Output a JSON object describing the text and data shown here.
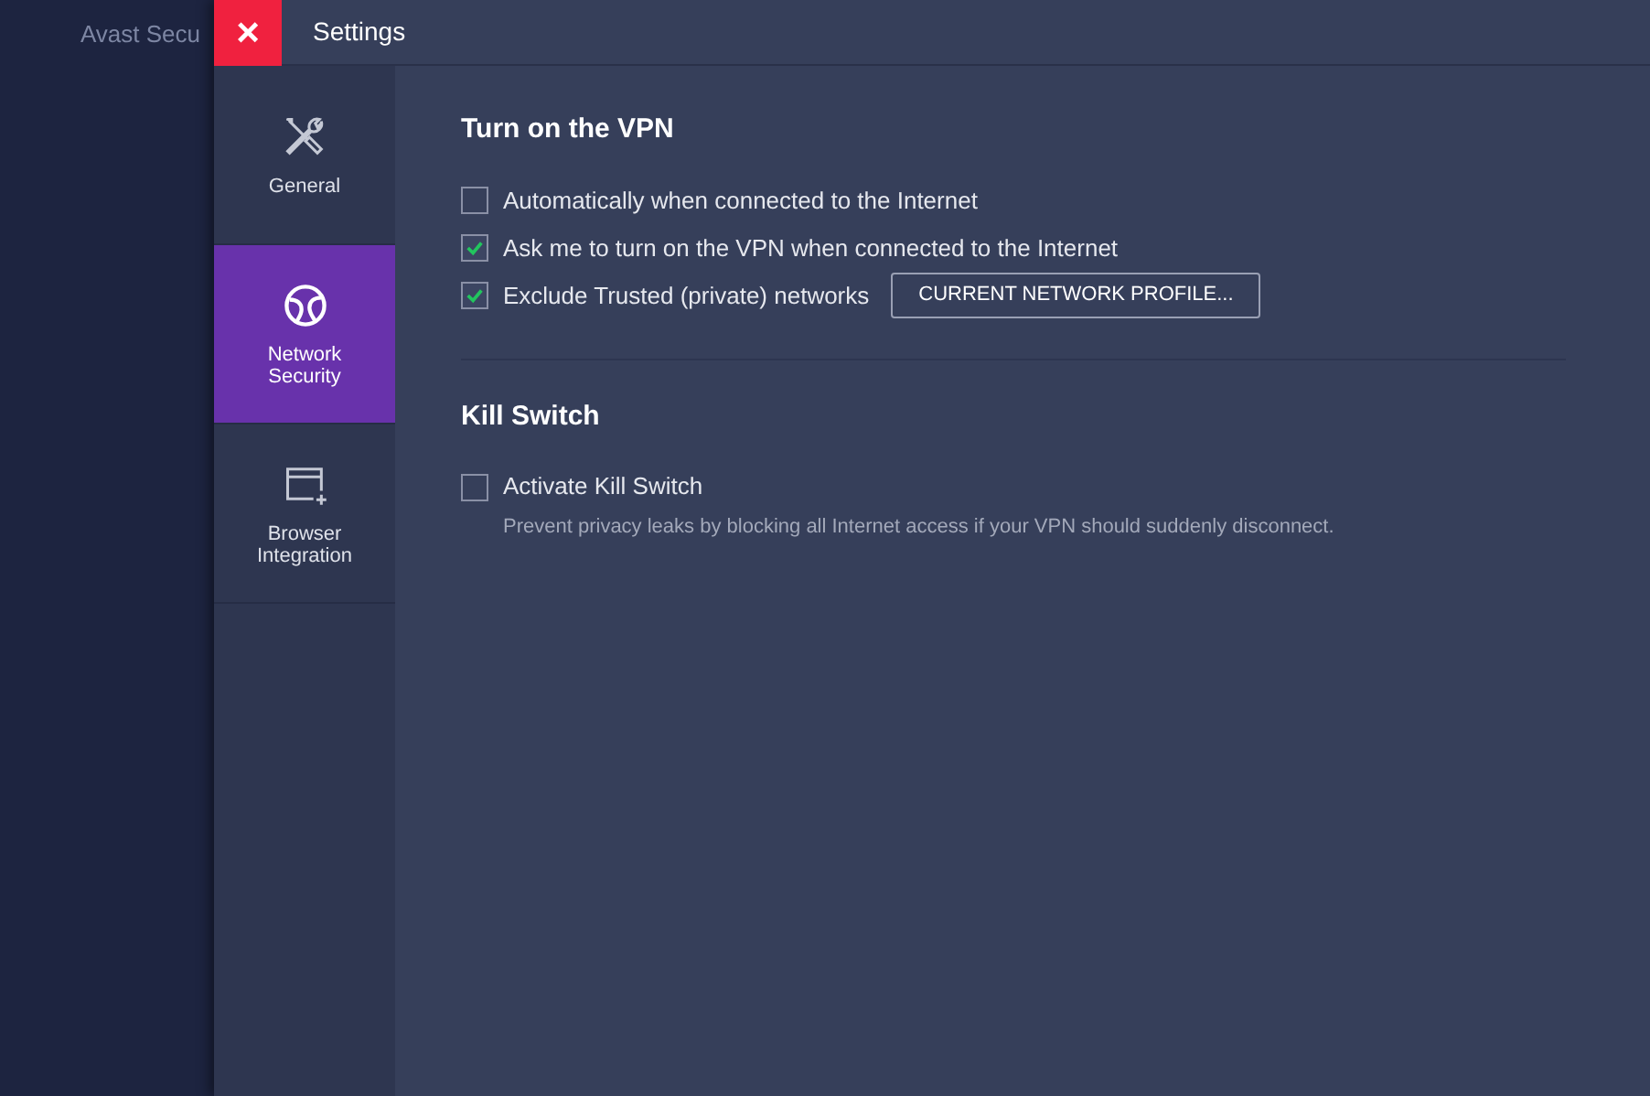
{
  "background_app": {
    "title": "Avast Secu"
  },
  "header": {
    "close_label": "×",
    "title": "Settings"
  },
  "sidebar": {
    "items": [
      {
        "label": "General",
        "kind": "tools",
        "selected": false
      },
      {
        "label": "Network Security",
        "kind": "globe",
        "selected": true
      },
      {
        "label": "Browser Integration",
        "kind": "browser",
        "selected": false
      }
    ]
  },
  "sections": [
    {
      "title": "Turn on the VPN",
      "options": [
        {
          "label": "Automatically when connected to the Internet",
          "checked": false
        },
        {
          "label": "Ask me to turn on the VPN when connected to the Internet",
          "checked": true
        },
        {
          "label": "Exclude Trusted (private) networks",
          "checked": true,
          "button": "CURRENT NETWORK PROFILE..."
        }
      ]
    },
    {
      "title": "Kill Switch",
      "options": [
        {
          "label": "Activate Kill Switch",
          "checked": false,
          "description": "Prevent privacy leaks by blocking all Internet access if your VPN should suddenly disconnect."
        }
      ]
    }
  ]
}
